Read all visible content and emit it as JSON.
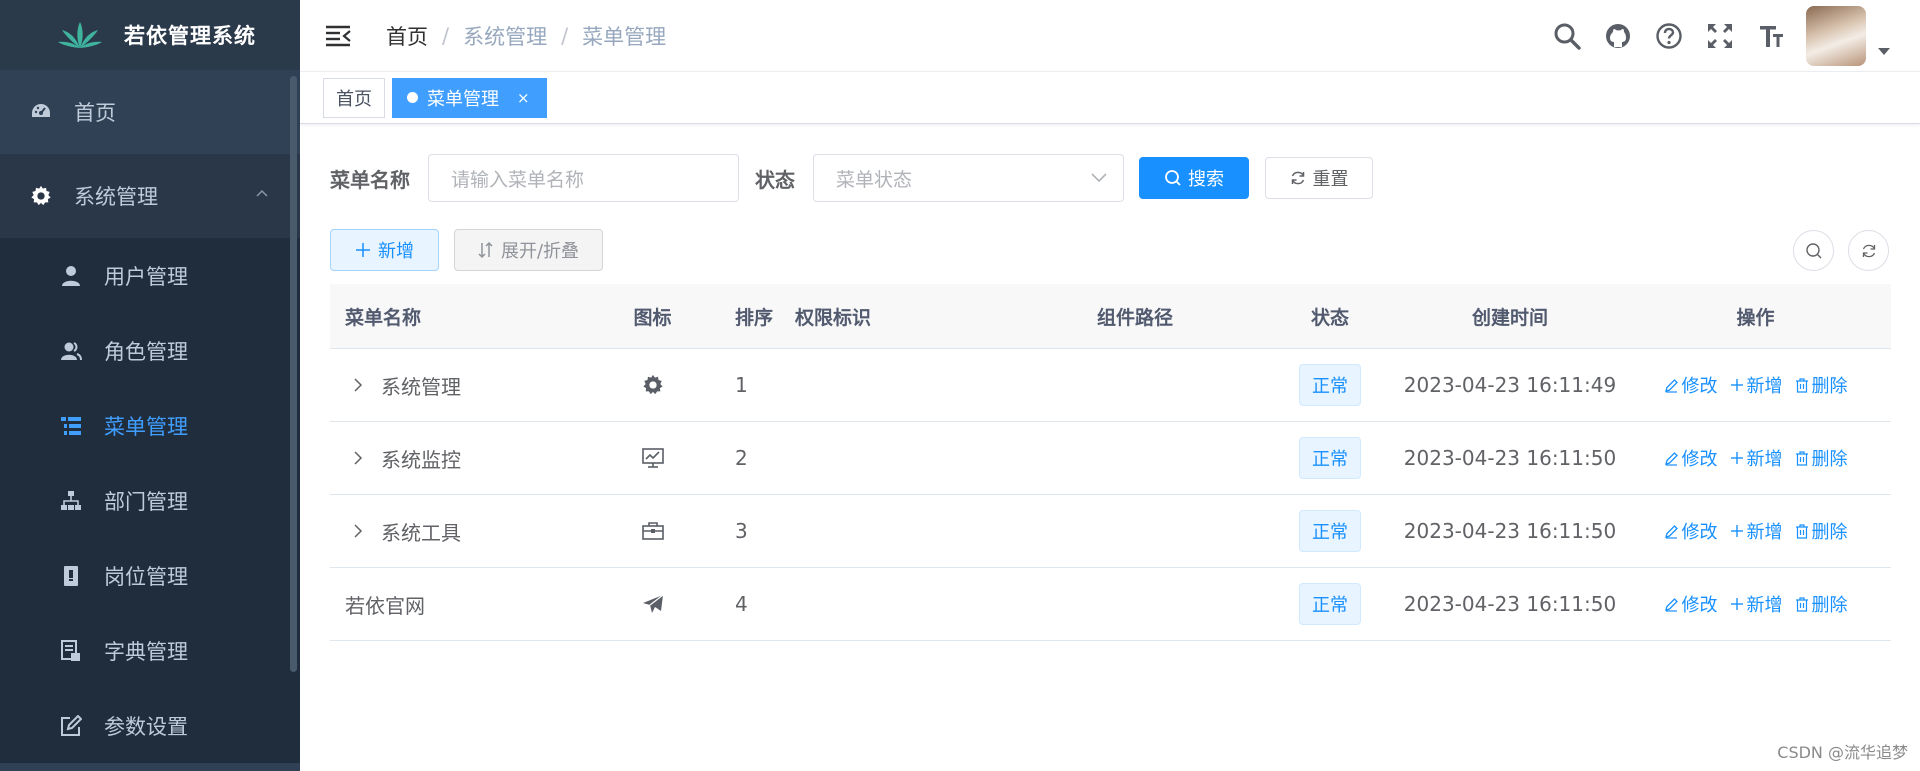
{
  "app": {
    "title": "若依管理系统"
  },
  "sidebar": {
    "items": [
      {
        "label": "首页",
        "icon": "dashboard-icon"
      },
      {
        "label": "系统管理",
        "icon": "gear-icon",
        "expanded": true
      }
    ],
    "submenu": [
      {
        "label": "用户管理",
        "icon": "user-icon"
      },
      {
        "label": "角色管理",
        "icon": "peoples-icon"
      },
      {
        "label": "菜单管理",
        "icon": "tree-table-icon",
        "active": true
      },
      {
        "label": "部门管理",
        "icon": "tree-icon"
      },
      {
        "label": "岗位管理",
        "icon": "post-icon"
      },
      {
        "label": "字典管理",
        "icon": "dict-icon"
      },
      {
        "label": "参数设置",
        "icon": "edit-icon"
      }
    ]
  },
  "breadcrumb": [
    "首页",
    "系统管理",
    "菜单管理"
  ],
  "navbar": {
    "icons": [
      "search-icon",
      "github-icon",
      "question-icon",
      "fullscreen-icon",
      "font-size-icon"
    ]
  },
  "tags": [
    {
      "label": "首页",
      "active": false
    },
    {
      "label": "菜单管理",
      "active": true,
      "close": "×"
    }
  ],
  "search_form": {
    "name_label": "菜单名称",
    "name_placeholder": "请输入菜单名称",
    "status_label": "状态",
    "status_placeholder": "菜单状态",
    "search_button": "搜索",
    "reset_button": "重置"
  },
  "toolbar": {
    "add_button": "新增",
    "expand_button": "展开/折叠"
  },
  "table": {
    "columns": [
      "菜单名称",
      "图标",
      "排序",
      "权限标识",
      "组件路径",
      "状态",
      "创建时间",
      "操作"
    ],
    "rows": [
      {
        "name": "系统管理",
        "icon": "gear-icon",
        "order": "1",
        "perms": "",
        "component": "",
        "status": "正常",
        "created": "2023-04-23 16:11:49",
        "expandable": true
      },
      {
        "name": "系统监控",
        "icon": "monitor-icon",
        "order": "2",
        "perms": "",
        "component": "",
        "status": "正常",
        "created": "2023-04-23 16:11:50",
        "expandable": true
      },
      {
        "name": "系统工具",
        "icon": "toolbox-icon",
        "order": "3",
        "perms": "",
        "component": "",
        "status": "正常",
        "created": "2023-04-23 16:11:50",
        "expandable": true
      },
      {
        "name": "若依官网",
        "icon": "paper-plane-icon",
        "order": "4",
        "perms": "",
        "component": "",
        "status": "正常",
        "created": "2023-04-23 16:11:50",
        "expandable": false
      }
    ],
    "ops": {
      "edit": "修改",
      "add": "新增",
      "delete": "删除"
    }
  },
  "watermark": "CSDN @流华追梦",
  "colors": {
    "sidebar_bg": "#304156",
    "sidebar_active": "#409eff",
    "primary": "#1890ff",
    "tag_active": "#409eff"
  }
}
